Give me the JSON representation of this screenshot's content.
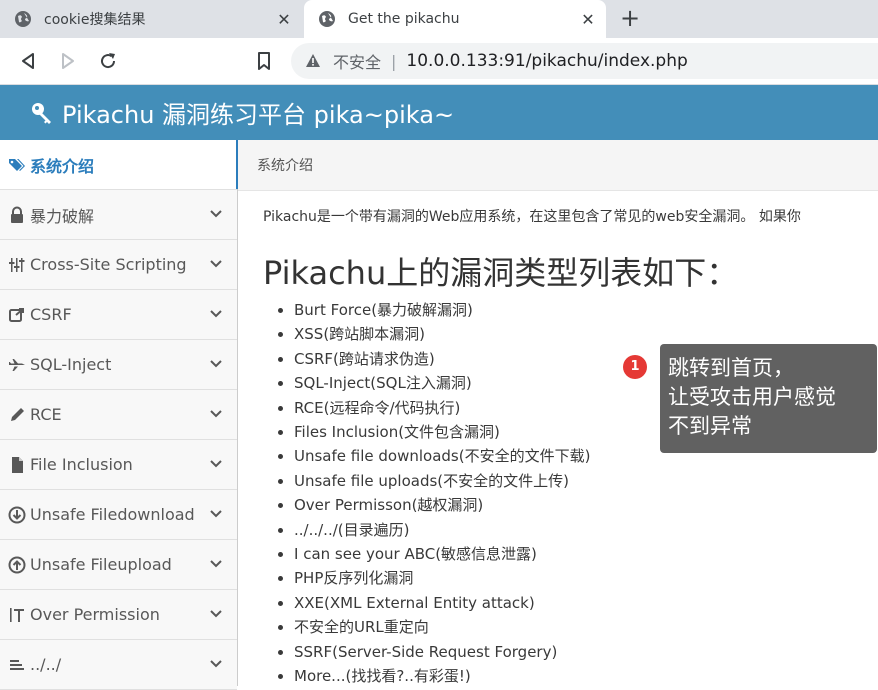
{
  "browser": {
    "tabs": [
      {
        "title": "cookie搜集结果",
        "active": false
      },
      {
        "title": "Get the pikachu",
        "active": true
      }
    ],
    "close_glyph": "✕",
    "new_tab_glyph": "+",
    "security_label": "不安全",
    "url_separator": "|",
    "url": "10.0.0.133:91/pikachu/index.php"
  },
  "app": {
    "title": "Pikachu 漏洞练习平台 pika~pika~",
    "brand_color": "#438eb9"
  },
  "sidebar": {
    "items": [
      {
        "label": "系统介绍",
        "icon": "tags-icon",
        "active": true
      },
      {
        "label": "暴力破解",
        "icon": "lock-icon"
      },
      {
        "label": "Cross-Site Scripting",
        "icon": "sliders-icon"
      },
      {
        "label": "CSRF",
        "icon": "share-icon"
      },
      {
        "label": "SQL-Inject",
        "icon": "plane-icon"
      },
      {
        "label": "RCE",
        "icon": "pencil-icon"
      },
      {
        "label": "File Inclusion",
        "icon": "file-icon"
      },
      {
        "label": "Unsafe Filedownload",
        "icon": "download-icon"
      },
      {
        "label": "Unsafe Fileupload",
        "icon": "upload-icon"
      },
      {
        "label": "Over Permission",
        "icon": "text-height-icon"
      },
      {
        "label": "../../",
        "icon": "align-left-icon"
      }
    ]
  },
  "main": {
    "breadcrumb": "系统介绍",
    "intro": "Pikachu是一个带有漏洞的Web应用系统，在这里包含了常见的web安全漏洞。 如果你",
    "heading": "Pikachu上的漏洞类型列表如下：",
    "vulns": [
      "Burt Force(暴力破解漏洞)",
      "XSS(跨站脚本漏洞)",
      "CSRF(跨站请求伪造)",
      "SQL-Inject(SQL注入漏洞)",
      "RCE(远程命令/代码执行)",
      "Files Inclusion(文件包含漏洞)",
      "Unsafe file downloads(不安全的文件下载)",
      "Unsafe file uploads(不安全的文件上传)",
      "Over Permisson(越权漏洞)",
      "../../../(目录遍历)",
      "I can see your ABC(敏感信息泄露)",
      "PHP反序列化漏洞",
      "XXE(XML External Entity attack)",
      "不安全的URL重定向",
      "SSRF(Server-Side Request Forgery)",
      "More...(找找看?..有彩蛋!)"
    ]
  },
  "annotation": {
    "step": "1",
    "text": "跳转到首页，\n让受攻击用户感觉\n不到异常"
  }
}
